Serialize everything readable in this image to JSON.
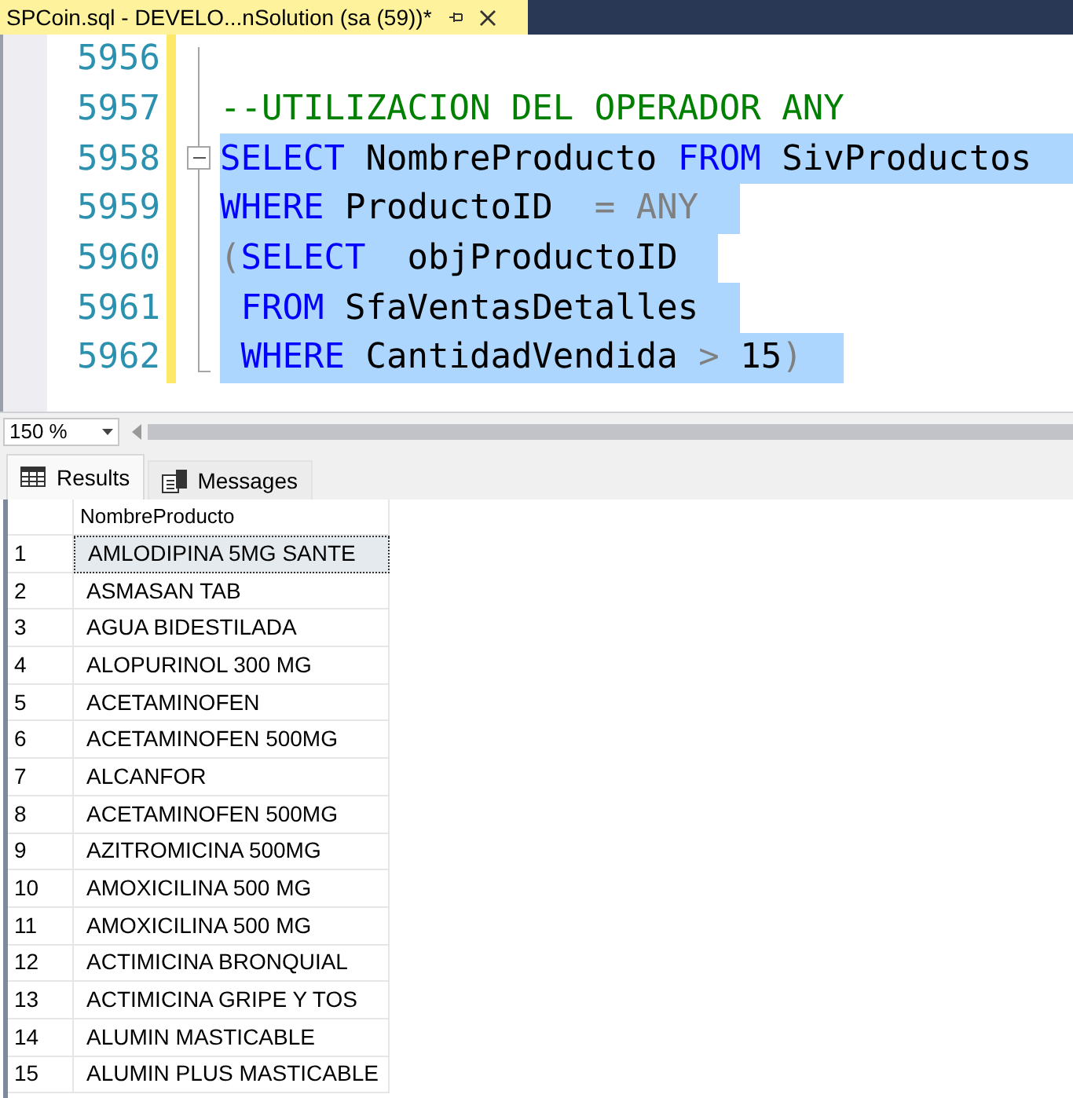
{
  "document_tab": {
    "title": "SPCoin.sql - DEVELO...nSolution (sa (59))*",
    "selected": true
  },
  "editor": {
    "lines": [
      {
        "number": "5956",
        "selected": false
      },
      {
        "number": "5957",
        "selected": false,
        "tokens": [
          {
            "kind": "comment",
            "text": "--UTILIZACION DEL OPERADOR ANY"
          }
        ]
      },
      {
        "number": "5958",
        "selected": true,
        "fold": {
          "expanded": true
        },
        "tokens": [
          {
            "kind": "keyword",
            "text": "SELECT"
          },
          {
            "kind": "text",
            "text": " NombreProducto "
          },
          {
            "kind": "keyword",
            "text": "FROM"
          },
          {
            "kind": "text",
            "text": " SivProductos"
          }
        ]
      },
      {
        "number": "5959",
        "selected": true,
        "tokens": [
          {
            "kind": "keyword",
            "text": "WHERE"
          },
          {
            "kind": "text",
            "text": " ProductoID  "
          },
          {
            "kind": "operator",
            "text": "= ANY"
          }
        ]
      },
      {
        "number": "5960",
        "selected": true,
        "tokens": [
          {
            "kind": "operator",
            "text": "("
          },
          {
            "kind": "keyword",
            "text": "SELECT"
          },
          {
            "kind": "text",
            "text": "  objProductoID"
          }
        ]
      },
      {
        "number": "5961",
        "selected": true,
        "tokens": [
          {
            "kind": "keyword",
            "text": " FROM"
          },
          {
            "kind": "text",
            "text": " SfaVentasDetalles"
          }
        ]
      },
      {
        "number": "5962",
        "selected": true,
        "tokens": [
          {
            "kind": "keyword",
            "text": " WHERE"
          },
          {
            "kind": "text",
            "text": " CantidadVendida "
          },
          {
            "kind": "operator",
            "text": ">"
          },
          {
            "kind": "text",
            "text": " 15"
          },
          {
            "kind": "operator",
            "text": ")"
          }
        ]
      }
    ]
  },
  "zoom": {
    "value": "150 %"
  },
  "result_tabs": [
    {
      "kind": "results",
      "label": "Results",
      "selected": true
    },
    {
      "kind": "messages",
      "label": "Messages",
      "selected": false
    }
  ],
  "grid": {
    "columns": [
      "NombreProducto"
    ],
    "rows": [
      {
        "number": "1",
        "cells": [
          "AMLODIPINA 5MG SANTE"
        ],
        "selected": true
      },
      {
        "number": "2",
        "cells": [
          "ASMASAN TAB"
        ],
        "selected": false
      },
      {
        "number": "3",
        "cells": [
          "AGUA BIDESTILADA"
        ],
        "selected": false
      },
      {
        "number": "4",
        "cells": [
          "ALOPURINOL 300 MG"
        ],
        "selected": false
      },
      {
        "number": "5",
        "cells": [
          "ACETAMINOFEN"
        ],
        "selected": false
      },
      {
        "number": "6",
        "cells": [
          "ACETAMINOFEN 500MG"
        ],
        "selected": false
      },
      {
        "number": "7",
        "cells": [
          "ALCANFOR"
        ],
        "selected": false
      },
      {
        "number": "8",
        "cells": [
          "ACETAMINOFEN 500MG"
        ],
        "selected": false
      },
      {
        "number": "9",
        "cells": [
          "AZITROMICINA 500MG"
        ],
        "selected": false
      },
      {
        "number": "10",
        "cells": [
          "AMOXICILINA  500 MG"
        ],
        "selected": false
      },
      {
        "number": "11",
        "cells": [
          "AMOXICILINA  500 MG"
        ],
        "selected": false
      },
      {
        "number": "12",
        "cells": [
          "ACTIMICINA BRONQUIAL"
        ],
        "selected": false
      },
      {
        "number": "13",
        "cells": [
          "ACTIMICINA GRIPE Y TOS"
        ],
        "selected": false
      },
      {
        "number": "14",
        "cells": [
          "ALUMIN MASTICABLE"
        ],
        "selected": false
      },
      {
        "number": "15",
        "cells": [
          "ALUMIN PLUS MASTICABLE"
        ],
        "selected": false
      }
    ]
  }
}
